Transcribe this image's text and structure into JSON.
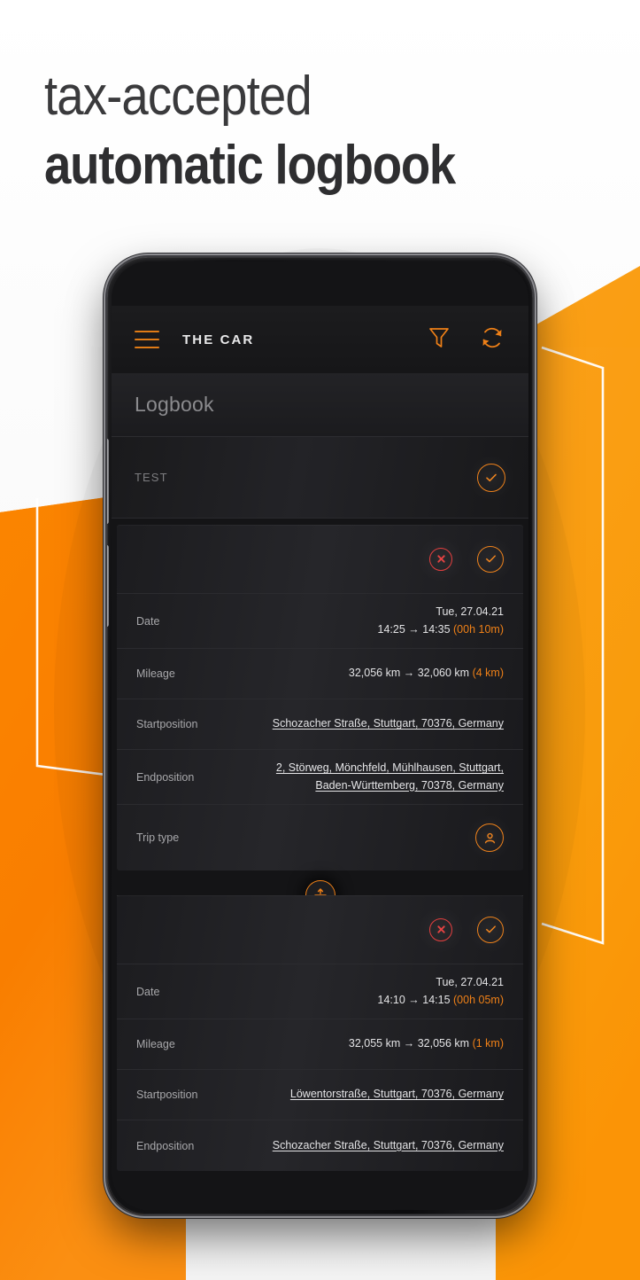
{
  "headline": {
    "line1": "tax-accepted",
    "line2": "automatic logbook"
  },
  "colors": {
    "accent_orange": "#ef8017",
    "brand_orange_left": "#f97a00",
    "brand_orange_right": "#f9a012",
    "danger_red": "#e23b3b",
    "screen_bg": "#141416"
  },
  "app": {
    "header": {
      "menu_icon": "hamburger-icon",
      "title": "THE CAR",
      "filter_icon": "filter-funnel-icon",
      "refresh_icon": "refresh-sync-icon"
    },
    "section": {
      "title": "Logbook"
    },
    "group": {
      "label": "TEST",
      "confirm_icon": "check-circle-icon"
    },
    "merge_icon": "merge-trips-icon",
    "labels": {
      "date": "Date",
      "mileage": "Mileage",
      "startposition": "Startposition",
      "endposition": "Endposition",
      "trip_type": "Trip type"
    },
    "trips": [
      {
        "reject_icon": "reject-circle-icon",
        "accept_icon": "accept-circle-icon",
        "date_day": "Tue, 27.04.21",
        "date_range": "14:25 → 14:35",
        "duration": "(00h 10m)",
        "mileage_range": "32,056 km → 32,060 km",
        "distance": "(4 km)",
        "startposition": "Schozacher Straße, Stuttgart, 70376, Germany",
        "endposition_line1": "2, Störweg, Mönchfeld, Mühlhausen, Stuttgart,",
        "endposition_line2": "Baden-Württemberg, 70378, Germany",
        "trip_type_icon": "person-trip-type-icon"
      },
      {
        "reject_icon": "reject-circle-icon",
        "accept_icon": "accept-circle-icon",
        "date_day": "Tue, 27.04.21",
        "date_range": "14:10 → 14:15",
        "duration": "(00h 05m)",
        "mileage_range": "32,055 km → 32,056 km",
        "distance": "(1 km)",
        "startposition": "Löwentorstraße, Stuttgart, 70376, Germany",
        "endposition_line1": "Schozacher Straße, Stuttgart, 70376, Germany",
        "endposition_line2": ""
      }
    ]
  }
}
